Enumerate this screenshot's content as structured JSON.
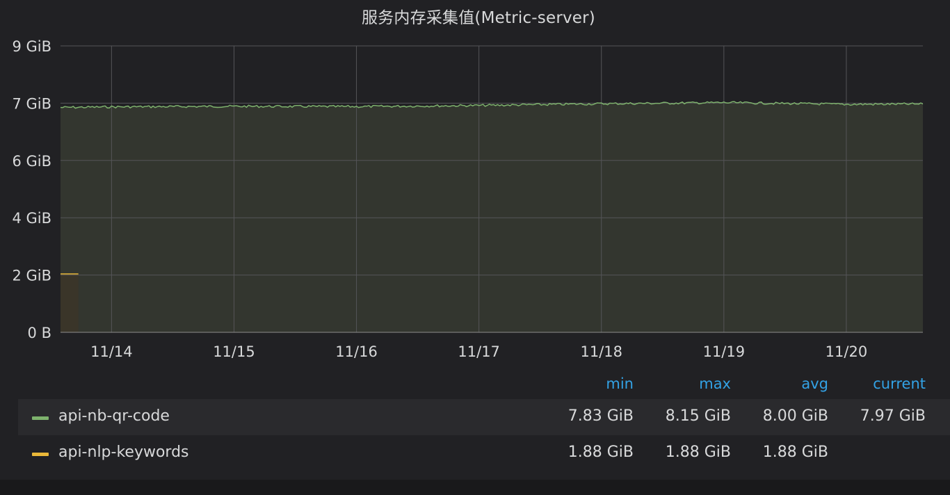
{
  "panel": {
    "title": "服务内存采集值(Metric-server)"
  },
  "chart_data": {
    "type": "area",
    "title": "服务内存采集值(Metric-server)",
    "x_ticks": [
      "11/14",
      "11/15",
      "11/16",
      "11/17",
      "11/18",
      "11/19",
      "11/20"
    ],
    "x_range": [
      "11/13 14:00",
      "11/20 15:00"
    ],
    "y_ticks": [
      {
        "label": "0 B",
        "value": 0
      },
      {
        "label": "2 GiB",
        "value": 2
      },
      {
        "label": "4 GiB",
        "value": 4
      },
      {
        "label": "6 GiB",
        "value": 6
      },
      {
        "label": "7 GiB",
        "value": 8
      },
      {
        "label": "9 GiB",
        "value": 10
      }
    ],
    "ylim": [
      0,
      10
    ],
    "grid": true,
    "series": [
      {
        "name": "api-nb-qr-code",
        "color": "#7eb26d",
        "fill": "#33362f",
        "x": [
          "11/13 14:00",
          "11/14 00:00",
          "11/15 00:00",
          "11/16 00:00",
          "11/17 00:00",
          "11/18 00:00",
          "11/19 00:00",
          "11/20 00:00",
          "11/20 15:00"
        ],
        "values": [
          7.85,
          7.87,
          7.89,
          7.88,
          7.92,
          7.98,
          8.02,
          7.96,
          7.97
        ]
      },
      {
        "name": "api-nlp-keywords",
        "color": "#eab839",
        "fill": "#3a3529",
        "x": [
          "11/13 14:00",
          "11/13 17:30"
        ],
        "values": [
          2.04,
          2.04
        ]
      }
    ]
  },
  "legend": {
    "headers": {
      "min": "min",
      "max": "max",
      "avg": "avg",
      "current": "current"
    },
    "rows": [
      {
        "name": "api-nb-qr-code",
        "color": "#7eb26d",
        "min": "7.83 GiB",
        "max": "8.15 GiB",
        "avg": "8.00 GiB",
        "current": "7.97 GiB"
      },
      {
        "name": "api-nlp-keywords",
        "color": "#eab839",
        "min": "1.88 GiB",
        "max": "1.88 GiB",
        "avg": "1.88 GiB",
        "current": ""
      }
    ]
  }
}
